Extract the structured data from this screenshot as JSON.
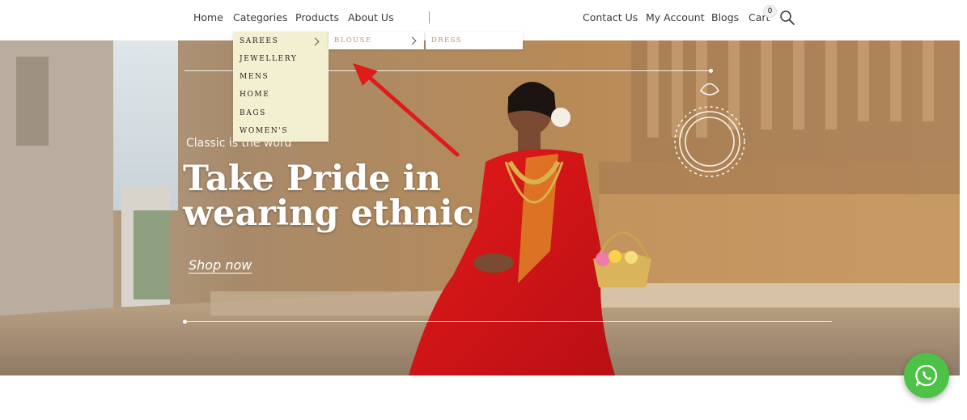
{
  "header": {
    "nav_left": [
      "Home",
      "Categories",
      "Products",
      "About Us"
    ],
    "nav_right": [
      "Contact Us",
      "My Account",
      "Blogs",
      "Cart"
    ],
    "cart_count": "0",
    "search_icon": "search-icon"
  },
  "categories_menu": {
    "items": [
      "SAREES",
      "JEWELLERY",
      "MENS",
      "HOME",
      "BAGS",
      "WOMEN'S"
    ]
  },
  "sarees_submenu": {
    "items": [
      "BLOUSE"
    ]
  },
  "blouse_submenu": {
    "items": [
      "DRESS"
    ]
  },
  "hero": {
    "tagline": "Classic is the word",
    "headline_line1": "Take Pride in",
    "headline_line2": "wearing ethnic",
    "cta": "Shop now"
  },
  "colors": {
    "menu_bg": "#f3f0d1",
    "submenu_text": "#b99565",
    "whatsapp": "#4dc247",
    "annotation_arrow": "#e01b1b"
  },
  "whatsapp_icon": "whatsapp-icon"
}
